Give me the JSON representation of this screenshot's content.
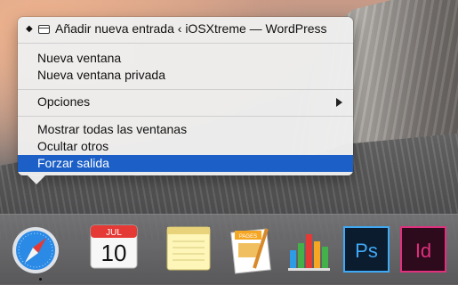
{
  "menu": {
    "window_title": "Añadir nueva entrada ‹ iOSXtreme — WordPress",
    "items": [
      {
        "label": "Nueva ventana"
      },
      {
        "label": "Nueva ventana privada"
      },
      {
        "label": "Opciones"
      },
      {
        "label": "Mostrar todas las ventanas"
      },
      {
        "label": "Ocultar otros"
      },
      {
        "label": "Forzar salida"
      }
    ],
    "selected_item": "Forzar salida",
    "selected_color": "#1b5fc7"
  },
  "dock": {
    "calendar": {
      "month": "JUL",
      "day": "10"
    },
    "pages_badge": "PAGES",
    "photoshop_label": "Ps",
    "indesign_label": "Id",
    "apps": [
      "Safari",
      "Calendario",
      "Notas",
      "Pages",
      "Numbers",
      "Photoshop",
      "InDesign"
    ]
  }
}
